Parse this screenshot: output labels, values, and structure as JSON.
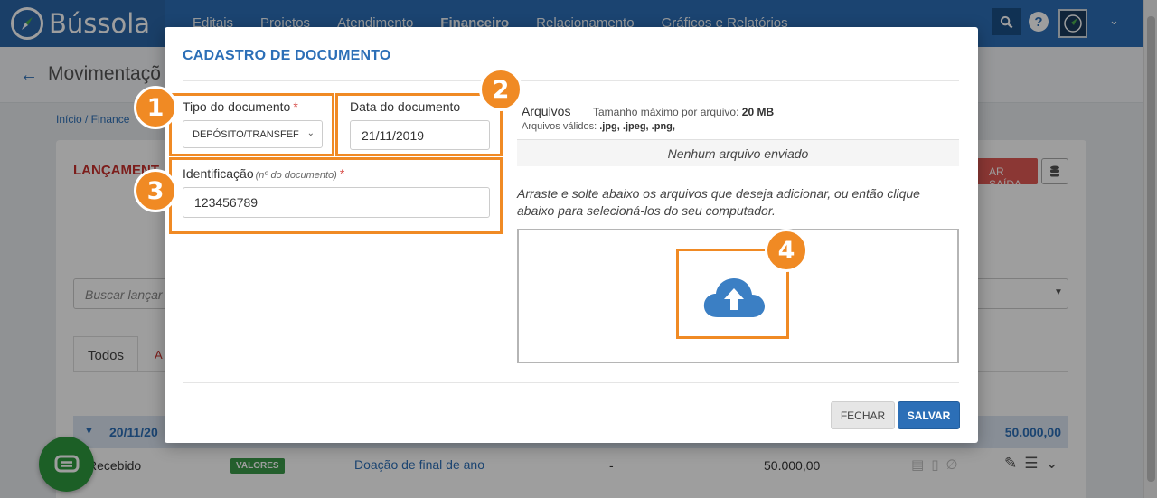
{
  "app": {
    "name": "Bússola"
  },
  "nav": {
    "items": [
      "Editais",
      "Projetos",
      "Atendimento",
      "Financeiro",
      "Relacionamento",
      "Gráficos e Relatórios"
    ],
    "active": "Financeiro"
  },
  "header": {
    "help_glyph": "?"
  },
  "page": {
    "title": "Movimentaçõ",
    "breadcrumb": "Início / Finance"
  },
  "background": {
    "section_title": "LANÇAMENT",
    "action_button": "AR SAÍDA",
    "search_placeholder": "Buscar lançar",
    "tabs": [
      "Todos",
      "A"
    ],
    "group": {
      "date": "20/11/20",
      "total": "50.000,00"
    },
    "row": {
      "status": "Recebido",
      "badge": "VALORES",
      "description": "Doação de final de ano",
      "dash": "-",
      "value": "50.000,00"
    }
  },
  "modal": {
    "title": "CADASTRO DE DOCUMENTO",
    "doc_type": {
      "label": "Tipo do documento",
      "required": "*",
      "value": "DEPÓSITO/TRANSFEF"
    },
    "doc_date": {
      "label": "Data do documento",
      "value": "21/11/2019"
    },
    "identification": {
      "label": "Identificação",
      "hint": "(nº do documento)",
      "required": "*",
      "value": "123456789"
    },
    "files": {
      "title": "Arquivos",
      "max_size_label": "Tamanho máximo por arquivo:",
      "max_size_value": "20 MB",
      "valid_label": "Arquivos válidos:",
      "valid_value": ".jpg, .jpeg, .png,",
      "empty": "Nenhum arquivo enviado",
      "instructions": "Arraste e solte abaixo os arquivos que deseja adicionar, ou então clique abaixo para selecioná-los do seu computador."
    },
    "buttons": {
      "close": "FECHAR",
      "save": "SALVAR"
    }
  },
  "annotations": [
    "1",
    "2",
    "3",
    "4"
  ],
  "colors": {
    "primary": "#2c6fb7",
    "annotation": "#f08a24",
    "danger": "#d9534f",
    "success": "#2e9a3e"
  }
}
